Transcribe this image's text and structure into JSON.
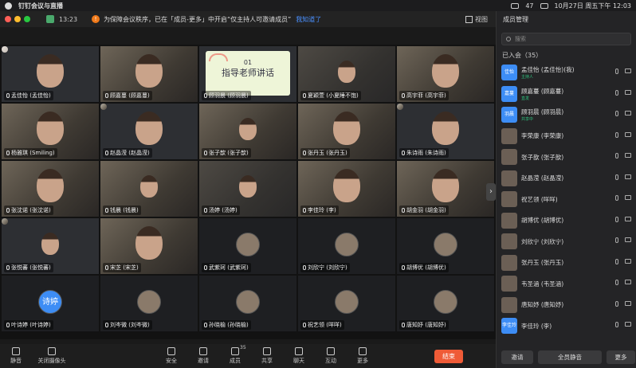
{
  "menubar": {
    "app_title": "钉钉会议与直播",
    "battery": "47",
    "clock": "10月27日 周五下午 12:03"
  },
  "meeting": {
    "elapsed": "13:23",
    "notice": "为保障会议秩序，已在「成员-更多」中开启“仅主持人可邀请成员”",
    "notice_link": "我知道了",
    "view_label": "视图"
  },
  "tiles": [
    {
      "name": "孟佳怡 (孟佳怡)",
      "kind": "video"
    },
    {
      "name": "顾嘉蔓 (顾嘉蔓)",
      "kind": "video"
    },
    {
      "name": "顾羽晨 (顾羽晨)",
      "kind": "slide",
      "slide_title": "指导老师讲话",
      "slide_num": "01"
    },
    {
      "name": "夏颖萱 (小夏睡不饱)",
      "kind": "dark"
    },
    {
      "name": "高宇菲 (高宇菲)",
      "kind": "video"
    },
    {
      "name": "杨雅琪 (Smiling)",
      "kind": "video"
    },
    {
      "name": "赵晶滢 (赵晶滢)",
      "kind": "video"
    },
    {
      "name": "张子歆 (张子歆)",
      "kind": "video"
    },
    {
      "name": "张丹玉 (张丹玉)",
      "kind": "video"
    },
    {
      "name": "朱诗雨 (朱诗雨)",
      "kind": "video"
    },
    {
      "name": "张沈诺 (张沈诺)",
      "kind": "video"
    },
    {
      "name": "钱晨 (钱晨)",
      "kind": "video"
    },
    {
      "name": "汤婷 (汤婷)",
      "kind": "dark"
    },
    {
      "name": "李佳玲 (李)",
      "kind": "video"
    },
    {
      "name": "胡金羽 (胡金羽)",
      "kind": "video"
    },
    {
      "name": "张悦蕃 (张悦蕃)",
      "kind": "video"
    },
    {
      "name": "宋芝 (宋芝)",
      "kind": "video"
    },
    {
      "name": "武紫珂 (武紫珂)",
      "kind": "avatar"
    },
    {
      "name": "刘欣宁 (刘欣宁)",
      "kind": "avatar"
    },
    {
      "name": "胡博优 (胡博优)",
      "kind": "avatar"
    },
    {
      "name": "叶诗婷 (叶诗婷)",
      "kind": "text_avatar",
      "avatar_text": "诗婷"
    },
    {
      "name": "刘岑微 (刘岑微)",
      "kind": "avatar"
    },
    {
      "name": "孙晓榆 (孙晓榆)",
      "kind": "avatar"
    },
    {
      "name": "祝艺领 (咩咩)",
      "kind": "avatar"
    },
    {
      "name": "唐知妤 (唐知妤)",
      "kind": "avatar"
    }
  ],
  "toolbar": {
    "mute": "静音",
    "camera": "关闭摄像头",
    "security": "安全",
    "invite": "邀请",
    "members": "成员",
    "members_count": "35",
    "share": "共享",
    "chat": "聊天",
    "interact": "互动",
    "more": "更多",
    "end": "结束"
  },
  "panel": {
    "title": "成员管理",
    "search_placeholder": "搜索",
    "joined_label": "已入会（35）",
    "members": [
      {
        "name": "孟佳怡 (孟佳怡)(我)",
        "role": "主持人",
        "avatar": "佳怡",
        "blue": true
      },
      {
        "name": "顾嘉蔓 (顾嘉蔓)",
        "role": "直发",
        "avatar": "嘉蔓",
        "blue": true
      },
      {
        "name": "顾羽晨 (顾羽晨)",
        "role": "共享中",
        "avatar": "羽晨",
        "blue": true
      },
      {
        "name": "李荣康 (李荣康)",
        "role": "",
        "avatar": "",
        "blue": false
      },
      {
        "name": "张子歆 (张子歆)",
        "role": "",
        "avatar": "",
        "blue": false
      },
      {
        "name": "赵晶滢 (赵晶滢)",
        "role": "",
        "avatar": "",
        "blue": false
      },
      {
        "name": "祝艺领 (咩咩)",
        "role": "",
        "avatar": "",
        "blue": false
      },
      {
        "name": "胡博优 (胡博优)",
        "role": "",
        "avatar": "",
        "blue": false
      },
      {
        "name": "刘欣宁 (刘欣宁)",
        "role": "",
        "avatar": "",
        "blue": false
      },
      {
        "name": "张丹玉 (张丹玉)",
        "role": "",
        "avatar": "",
        "blue": false
      },
      {
        "name": "韦圣涵 (韦圣涵)",
        "role": "",
        "avatar": "",
        "blue": false
      },
      {
        "name": "唐知妤 (唐知妤)",
        "role": "",
        "avatar": "",
        "blue": false
      },
      {
        "name": "李佳玲 (李)",
        "role": "",
        "avatar": "李佳玲",
        "blue": true
      }
    ],
    "invite_btn": "邀请",
    "mute_all_btn": "全员静音",
    "more_btn": "更多"
  }
}
